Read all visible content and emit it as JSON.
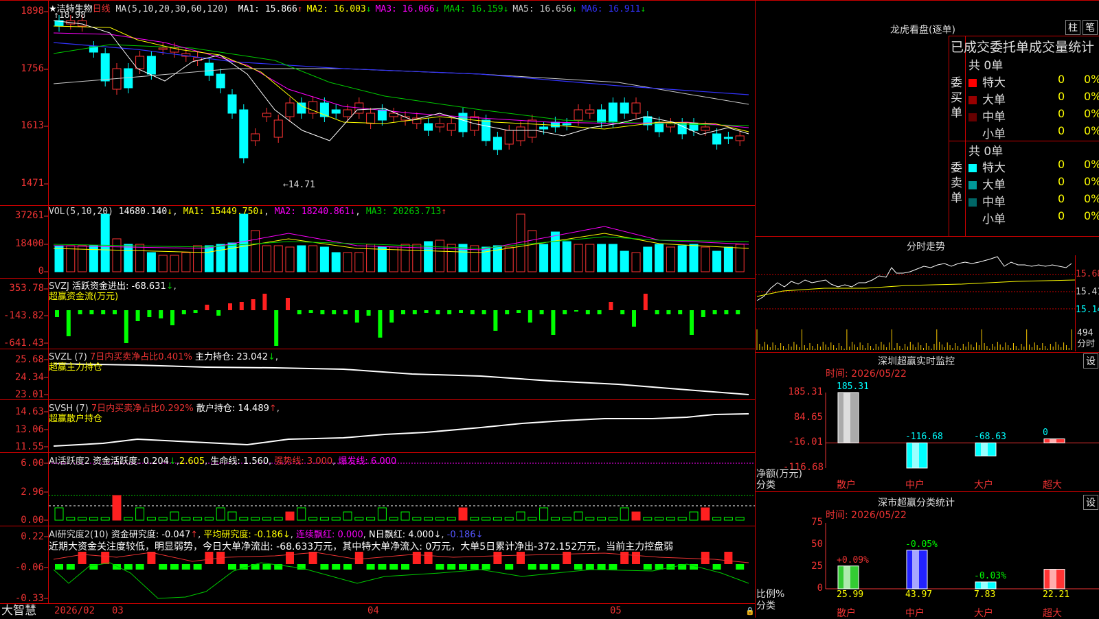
{
  "stock": {
    "title": "★洁特生物",
    "period": "日线",
    "ma_params": "MA(5,10,20,30,60,120)"
  },
  "ma": [
    {
      "label": "MA1: 15.866",
      "arrow": "↑",
      "color": "#ffffff"
    },
    {
      "label": "MA2: 16.003",
      "arrow": "↓",
      "color": "#ffff00"
    },
    {
      "label": "MA3: 16.066",
      "arrow": "↓",
      "color": "#ff00ff"
    },
    {
      "label": "MA4: 16.159",
      "arrow": "↓",
      "color": "#00cc00"
    },
    {
      "label": "MA5: 16.656",
      "arrow": "↓",
      "color": "#cccccc"
    },
    {
      "label": "MA6: 16.911",
      "arrow": "↓",
      "color": "#3333ff"
    }
  ],
  "price_axis": {
    "ticks": [
      "1898",
      "1756",
      "1613",
      "1471"
    ],
    "high_label": "18.98",
    "low_label": "14.71"
  },
  "vol": {
    "header": "VOL(5,10,20)",
    "value": "14680.140",
    "ma1": "MA1: 15449.750",
    "ma2": "MA2: 18240.861",
    "ma3": "MA3: 20263.713",
    "ticks": [
      "37261",
      "18400",
      "0"
    ]
  },
  "svzj": {
    "header": "SVZJ",
    "text1": "活跃资金进出: -68.631",
    "arrow1": "↓",
    "sub": "超赢资金流(万元)",
    "ticks": [
      "353.78",
      "-143.82",
      "-641.43"
    ]
  },
  "svzl": {
    "header": "SVZL (7)",
    "text1": "7日内买卖净占比0.401%",
    "text2": "主力持仓: 23.042",
    "arrow": "↓",
    "sub": "超赢主力持仓",
    "ticks": [
      "25.68",
      "24.34",
      "23.01"
    ]
  },
  "svsh": {
    "header": "SVSH (7)",
    "text1": "7日内买卖净占比0.292%",
    "text2": "散户持仓: 14.489",
    "arrow": "↑",
    "sub": "超赢散户持仓",
    "ticks": [
      "14.63",
      "13.06",
      "11.55"
    ]
  },
  "ai1": {
    "header": "AI活跃度2",
    "text1": "资金活跃度: 0.204",
    "v2": "2.605",
    "v3": "生命线: 1.560",
    "v4": "强势线: 3.000",
    "v5": "爆发线: 6.000",
    "ticks": [
      "6.00",
      "2.96",
      "0.00"
    ]
  },
  "ai2": {
    "header": "AI研究度2(10)",
    "text1": "资金研究度: -0.047",
    "text2": "平均研究度: -0.186",
    "text3": "连续飘红: 0.000",
    "text4": "N日飘红: 4.000",
    "text5": "-0.186",
    "comment": "近期大资金关注度较低，明显弱势，今日大单净流出: -68.633万元，其中特大单净流入: 0万元，大单5日累计净出-372.152万元，当前主力控盘弱",
    "ticks": [
      "0.22",
      "-0.06",
      "-0.33"
    ]
  },
  "footer": {
    "logo": "大智慧",
    "labels": [
      "2026/02",
      "03",
      "04",
      "05"
    ]
  },
  "lhb": {
    "title": "龙虎看盘(逐单)",
    "tab1": "柱",
    "tab2": "笔",
    "subtitle": "已成交委托单成交量统计",
    "buy": {
      "side": "委买单",
      "total": "共 0单",
      "rows": [
        {
          "name": "特大",
          "count": "0",
          "pct": "0%",
          "color": "#ff0000"
        },
        {
          "name": "大单",
          "count": "0",
          "pct": "0%",
          "color": "#990000"
        },
        {
          "name": "中单",
          "count": "0",
          "pct": "0%",
          "color": "#660000"
        },
        {
          "name": "小单",
          "count": "0",
          "pct": "0%",
          "color": "#000000"
        }
      ]
    },
    "sell": {
      "side": "委卖单",
      "total": "共 0单",
      "rows": [
        {
          "name": "特大",
          "count": "0",
          "pct": "0%",
          "color": "#00ffff"
        },
        {
          "name": "大单",
          "count": "0",
          "pct": "0%",
          "color": "#009999"
        },
        {
          "name": "中单",
          "count": "0",
          "pct": "0%",
          "color": "#006666"
        },
        {
          "name": "小单",
          "count": "0",
          "pct": "0%",
          "color": "#000000"
        }
      ]
    }
  },
  "intraday": {
    "title": "分时走势",
    "ticks": [
      "15.68",
      "15.41",
      "15.14"
    ],
    "vol_tick": "494",
    "vol_label": "分时"
  },
  "monitor": {
    "title": "深圳超赢实时监控",
    "set": "设",
    "time": "时间: 2026/05/22",
    "y_ticks": [
      "185.31",
      "84.65",
      "-16.01",
      "-116.68"
    ],
    "ylabel": "净额(万元)",
    "xlabel": "分类",
    "categories": [
      "散户",
      "中户",
      "大户",
      "超大"
    ],
    "chart_data": {
      "type": "bar",
      "categories": [
        "散户",
        "中户",
        "大户",
        "超大"
      ],
      "values": [
        185.31,
        -116.68,
        -68.63,
        0
      ],
      "value_labels": [
        "185.31",
        "-116.68",
        "-68.63",
        "0"
      ],
      "ylim": [
        -116.68,
        185.31
      ],
      "ylabel": "净额(万元)",
      "xlabel": "分类"
    }
  },
  "classify": {
    "title": "深市超赢分类统计",
    "set": "设",
    "time": "时间: 2026/05/22",
    "y_ticks": [
      "75",
      "50",
      "25",
      "0"
    ],
    "ylabel": "比例%",
    "xlabel": "分类",
    "categories": [
      "散户",
      "中户",
      "大户",
      "超大"
    ],
    "chart_data": {
      "type": "bar",
      "categories": [
        "散户",
        "中户",
        "大户",
        "超大"
      ],
      "values": [
        25.99,
        43.97,
        7.83,
        22.21
      ],
      "value_labels": [
        "25.99",
        "43.97",
        "7.83",
        "22.21"
      ],
      "change_labels": [
        "+0.09%",
        "-0.05%",
        "-0.03%",
        ""
      ],
      "ylim": [
        0,
        75
      ],
      "ylabel": "比例%",
      "xlabel": "分类"
    }
  }
}
